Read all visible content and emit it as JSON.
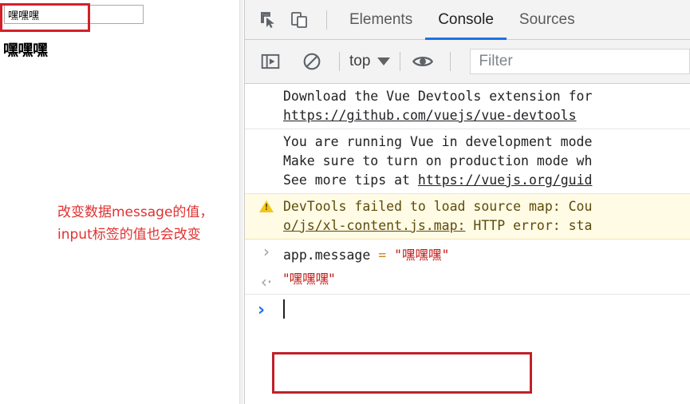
{
  "page": {
    "input_value": "嘿嘿嘿",
    "input_placeholder": "",
    "message_text": "嘿嘿嘿",
    "annotation_note": "改变数据message的值，input标签的值也会改变",
    "annotation_color": "#e03030"
  },
  "devtools": {
    "toolbar_icons": [
      {
        "name": "inspect-element-icon",
        "title": "Inspect"
      },
      {
        "name": "device-toolbar-icon",
        "title": "Toggle device toolbar"
      }
    ],
    "tabs": [
      {
        "label": "Elements",
        "active": false
      },
      {
        "label": "Console",
        "active": true
      },
      {
        "label": "Sources",
        "active": false
      }
    ],
    "console_toolbar": {
      "sidebar_toggle_icon": "console-sidebar-icon",
      "clear_icon": "clear-console-icon",
      "context_value": "top",
      "eye_icon": "live-expression-icon",
      "filter_placeholder": "Filter",
      "filter_value": ""
    },
    "messages": [
      {
        "type": "log",
        "lines": [
          "Download the Vue Devtools extension for",
          "https://github.com/vuejs/vue-devtools"
        ],
        "link_line": 1
      },
      {
        "type": "log",
        "lines": [
          "You are running Vue in development mode",
          "Make sure to turn on production mode wh",
          "See more tips at https://vuejs.org/guid"
        ],
        "link_prefix": "See more tips at ",
        "link_text": "https://vuejs.org/guid"
      },
      {
        "type": "warning",
        "lines": [
          "DevTools failed to load source map: Cou",
          "o/js/xl-content.js.map: HTTP error: sta"
        ],
        "link_text": "o/js/xl-content.js.map:",
        "link_rest": " HTTP error: sta"
      }
    ],
    "command": {
      "gutter": "›",
      "object": "app.message ",
      "operator": "= ",
      "quote_open": "\"",
      "string": "嘿嘿嘿",
      "quote_close": "\""
    },
    "result": {
      "gutter": "‹·",
      "value": "\"嘿嘿嘿\""
    },
    "prompt": {
      "gutter": "›",
      "value": ""
    }
  },
  "colors": {
    "accent_tab": "#1a73e8",
    "annotation_red": "#c0202a",
    "warning_bg": "#fffbe5",
    "string_red": "#c41a16",
    "operator_orange": "#c9851b"
  }
}
